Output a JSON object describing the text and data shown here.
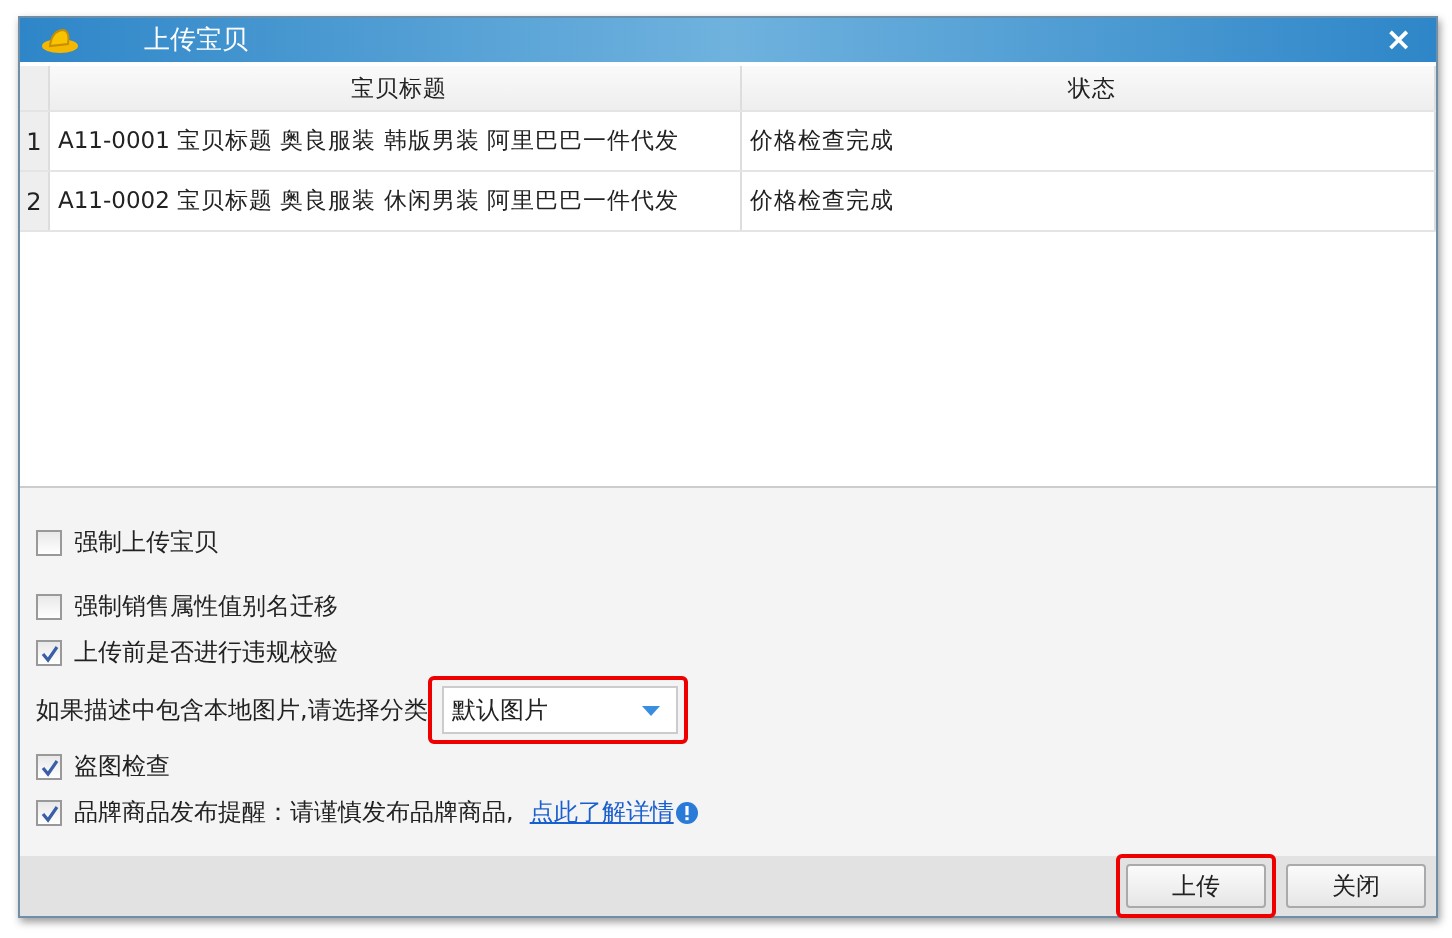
{
  "window": {
    "title": "上传宝贝",
    "close": "×"
  },
  "table": {
    "columns": [
      "宝贝标题",
      "状态"
    ],
    "rows": [
      {
        "index": "1",
        "cells": [
          "A11-0001 宝贝标题 奥良服装 韩版男装 阿里巴巴一件代发",
          "价格检查完成"
        ]
      },
      {
        "index": "2",
        "cells": [
          "A11-0002 宝贝标题 奥良服装 休闲男装 阿里巴巴一件代发",
          "价格检查完成"
        ]
      }
    ]
  },
  "options": [
    {
      "kind": "checkbox",
      "label": "强制上传宝贝",
      "checked": false
    },
    {
      "kind": "checkbox",
      "label": "强制销售属性值别名迁移",
      "checked": false
    },
    {
      "kind": "checkbox",
      "label": "上传前是否进行违规校验",
      "checked": true
    },
    {
      "kind": "select",
      "label": "如果描述中包含本地图片,请选择分类",
      "value": "默认图片",
      "highlighted": true
    },
    {
      "kind": "checkbox",
      "label": "盗图检查",
      "checked": true
    },
    {
      "kind": "checkbox",
      "label": "品牌商品发布提醒：请谨慎发布品牌商品,",
      "checked": true,
      "link": "点此了解详情"
    }
  ],
  "buttons": [
    {
      "label": "上传",
      "highlighted": true
    },
    {
      "label": "关闭",
      "highlighted": false
    }
  ]
}
